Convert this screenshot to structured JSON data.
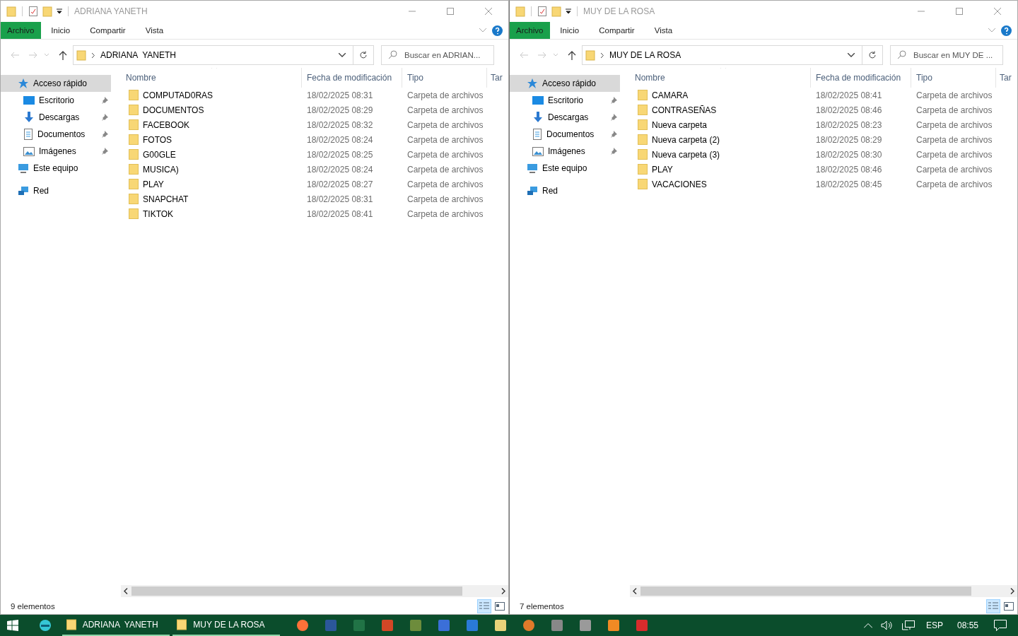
{
  "windows": [
    {
      "title": "ADRIANA  YANETH",
      "tabs": [
        {
          "label": "Archivo",
          "kind": "file"
        },
        {
          "label": "Inicio",
          "kind": "tab"
        },
        {
          "label": "Compartir",
          "kind": "tab"
        },
        {
          "label": "Vista",
          "kind": "tab"
        }
      ],
      "address": "ADRIANA  YANETH",
      "search": {
        "placeholder": "Buscar en ADRIAN..."
      },
      "nav": [
        {
          "label": "Acceso rápido",
          "kind": "star",
          "selected": true,
          "children": [
            {
              "label": "Escritorio",
              "kind": "desktop",
              "pinned": true,
              "selected": false
            },
            {
              "label": "Descargas",
              "kind": "download",
              "pinned": true,
              "selected": false
            },
            {
              "label": "Documentos",
              "kind": "documents",
              "pinned": true,
              "selected": false
            },
            {
              "label": "Imágenes",
              "kind": "pictures",
              "pinned": true,
              "selected": false
            }
          ]
        },
        {
          "label": "Este equipo",
          "kind": "pc",
          "selected": false
        },
        {
          "label": "Red",
          "kind": "network",
          "selected": false
        }
      ],
      "columns": [
        "Nombre",
        "Fecha de modificación",
        "Tipo",
        "Tar"
      ],
      "rows": [
        {
          "name": "COMPUTAD0RAS",
          "date": "18/02/2025 08:31",
          "type": "Carpeta de archivos"
        },
        {
          "name": "DOCUMENTOS",
          "date": "18/02/2025 08:29",
          "type": "Carpeta de archivos"
        },
        {
          "name": "FACEBOOK",
          "date": "18/02/2025 08:32",
          "type": "Carpeta de archivos"
        },
        {
          "name": "FOTOS",
          "date": "18/02/2025 08:24",
          "type": "Carpeta de archivos"
        },
        {
          "name": "G00GLE",
          "date": "18/02/2025 08:25",
          "type": "Carpeta de archivos"
        },
        {
          "name": "MUSICA)",
          "date": "18/02/2025 08:24",
          "type": "Carpeta de archivos"
        },
        {
          "name": "PLAY",
          "date": "18/02/2025 08:27",
          "type": "Carpeta de archivos"
        },
        {
          "name": "SNAPCHAT",
          "date": "18/02/2025 08:31",
          "type": "Carpeta de archivos"
        },
        {
          "name": "TIKTOK",
          "date": "18/02/2025 08:41",
          "type": "Carpeta de archivos"
        }
      ],
      "status": "9 elementos"
    },
    {
      "title": "MUY DE LA ROSA",
      "tabs": [
        {
          "label": "Archivo",
          "kind": "file"
        },
        {
          "label": "Inicio",
          "kind": "tab"
        },
        {
          "label": "Compartir",
          "kind": "tab"
        },
        {
          "label": "Vista",
          "kind": "tab"
        }
      ],
      "address": "MUY DE LA ROSA",
      "search": {
        "placeholder": "Buscar en MUY DE ..."
      },
      "nav": [
        {
          "label": "Acceso rápido",
          "kind": "star",
          "selected": true,
          "children": [
            {
              "label": "Escritorio",
              "kind": "desktop",
              "pinned": true,
              "selected": false
            },
            {
              "label": "Descargas",
              "kind": "download",
              "pinned": true,
              "selected": false
            },
            {
              "label": "Documentos",
              "kind": "documents",
              "pinned": true,
              "selected": false
            },
            {
              "label": "Imágenes",
              "kind": "pictures",
              "pinned": true,
              "selected": false
            }
          ]
        },
        {
          "label": "Este equipo",
          "kind": "pc",
          "selected": false
        },
        {
          "label": "Red",
          "kind": "network",
          "selected": false
        }
      ],
      "columns": [
        "Nombre",
        "Fecha de modificación",
        "Tipo",
        "Tar"
      ],
      "rows": [
        {
          "name": "CAMARA",
          "date": "18/02/2025 08:41",
          "type": "Carpeta de archivos"
        },
        {
          "name": "CONTRASEÑAS",
          "date": "18/02/2025 08:46",
          "type": "Carpeta de archivos"
        },
        {
          "name": "Nueva carpeta",
          "date": "18/02/2025 08:23",
          "type": "Carpeta de archivos"
        },
        {
          "name": "Nueva carpeta (2)",
          "date": "18/02/2025 08:29",
          "type": "Carpeta de archivos"
        },
        {
          "name": "Nueva carpeta (3)",
          "date": "18/02/2025 08:30",
          "type": "Carpeta de archivos"
        },
        {
          "name": "PLAY",
          "date": "18/02/2025 08:46",
          "type": "Carpeta de archivos"
        },
        {
          "name": "VACACIONES",
          "date": "18/02/2025 08:45",
          "type": "Carpeta de archivos"
        }
      ],
      "status": "7 elementos"
    }
  ],
  "taskbar": {
    "windows": [
      {
        "label": "ADRIANA  YANETH"
      },
      {
        "label": "MUY DE LA ROSA"
      }
    ],
    "language": "ESP",
    "time": "08:55"
  }
}
